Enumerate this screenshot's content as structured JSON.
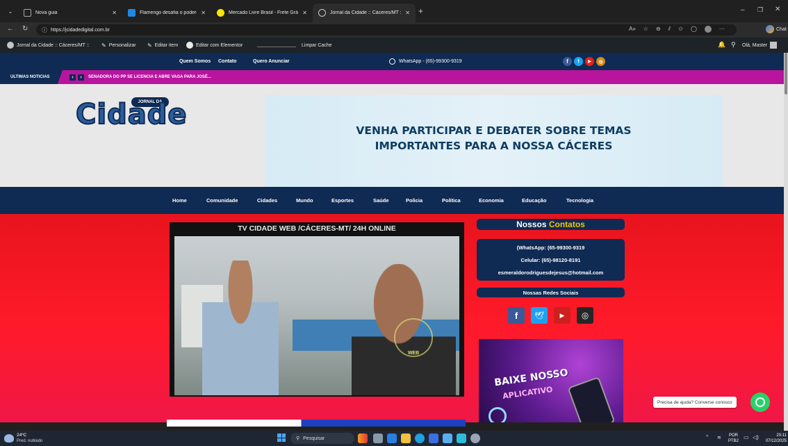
{
  "browser": {
    "tabs": [
      {
        "title": "Nova guia",
        "color": "#888888"
      },
      {
        "title": "Flamengo desafia o poderoso PSG",
        "color": "#1e88e5"
      },
      {
        "title": "Mercado Livre Brasil - Frete Grátis",
        "color": "#ffe600"
      },
      {
        "title": "Jornal da Cidade :: Cáceres/MT ::",
        "color": "#aaaaaa"
      }
    ],
    "new_tab": "+",
    "url": "https://jcidadedigital.com.br",
    "chat_label": "Chat"
  },
  "wp_bar": {
    "site": "Jornal da Cidade :: Cáceres/MT ::",
    "customize": "Personalizar",
    "edit": "Editar item",
    "elementor": "Editar com Elementor",
    "cache": "Limpar Cache",
    "greeting": "Olá, Master"
  },
  "top_nav": {
    "links": [
      "Quem Somos",
      "Contato",
      "Quero Anunciar"
    ],
    "whatsapp": "WhatsApp - (65)-99300-9319"
  },
  "ticker": {
    "label": "ULTIMAS NOTICIAS",
    "headline": "SENADORA DO PP SE LICENCIA E ABRE VAGA PARA JOSÉ..."
  },
  "logo": {
    "small": "JORNAL DA",
    "big": "Cidade"
  },
  "banner": {
    "line1": "VENHA PARTICIPAR E DEBATER SOBRE TEMAS",
    "line2": "IMPORTANTES PARA A NOSSA CÁCERES"
  },
  "main_nav": [
    "Home",
    "Comunidade",
    "Cidades",
    "Mundo",
    "Esportes",
    "Saúde",
    "Policia",
    "Política",
    "Economia",
    "Educação",
    "Tecnologia"
  ],
  "video": {
    "title": "TV CIDADE WEB /CÁCERES-MT/ 24H ONLINE",
    "watermark": "WEB"
  },
  "sidebar": {
    "contacts_title_a": "Nossos",
    "contacts_title_b": "Contatos",
    "whatsapp": "(WhatsApp: (65-99300-9319",
    "cell": "Celular: (65)-98120-8191",
    "email": "esmeraldorodriguesdejesus@hotmail.com",
    "social_title": "Nossas Redes Sociais",
    "app_line1": "BAIXE NOSSO",
    "app_line2": "APLICATIVO"
  },
  "chat_bubble": "Precisa de ajuda? Converse conosco",
  "taskbar": {
    "temp": "24ºC",
    "weather": "Pred. nublado",
    "search": "Pesquisar",
    "lang1": "POR",
    "lang2": "PTB2",
    "time": "20:11",
    "date": "07/12/2025"
  },
  "colors": {
    "navy": "#0f2a53",
    "magenta": "#b8149e",
    "red": "#e8141d",
    "gold": "#f5c400",
    "whatsapp": "#25d366"
  }
}
